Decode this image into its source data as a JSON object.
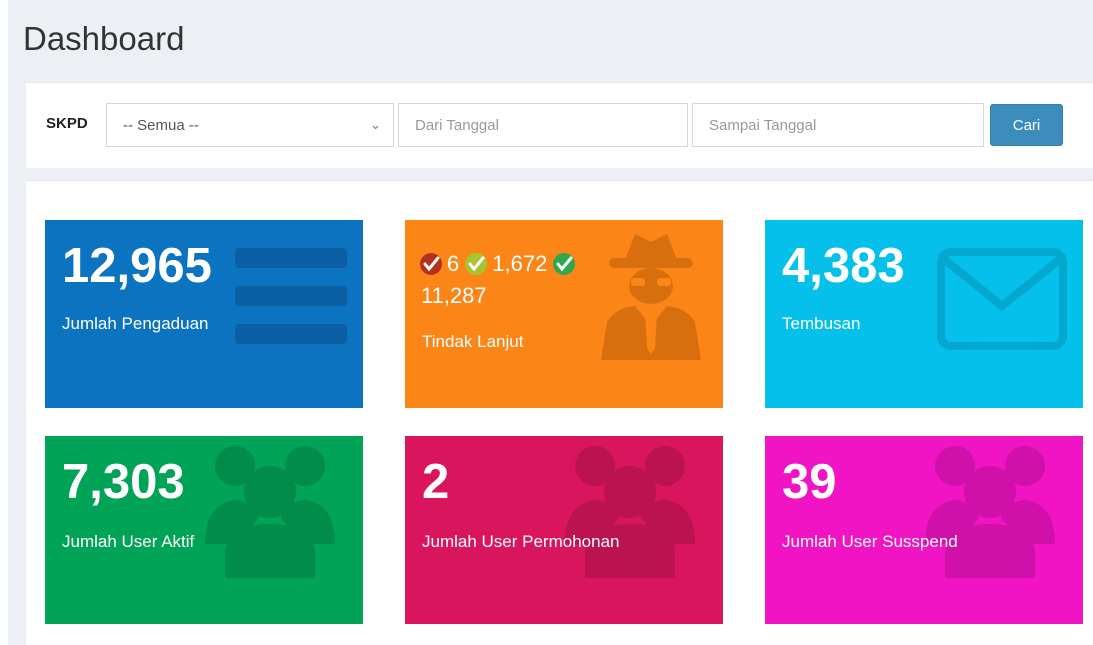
{
  "page": {
    "title": "Dashboard"
  },
  "filter": {
    "skpd_label": "SKPD",
    "skpd_selected": "-- Semua --",
    "from_placeholder": "Dari Tanggal",
    "to_placeholder": "Sampai Tanggal",
    "search_label": "Cari"
  },
  "cards": {
    "pengaduan": {
      "value": "12,965",
      "label": "Jumlah Pengaduan",
      "color": "#0c73c0",
      "icon": "list-icon"
    },
    "tindak_lanjut": {
      "rejected": "6",
      "processed": "1,672",
      "completed": "11,287",
      "label": "Tindak Lanjut",
      "color": "#fc8517",
      "icon": "user-secret-icon"
    },
    "tembusan": {
      "value": "4,383",
      "label": "Tembusan",
      "color": "#05c0ea",
      "icon": "envelope-icon"
    },
    "user_aktif": {
      "value": "7,303",
      "label": "Jumlah User Aktif",
      "color": "#01a357",
      "icon": "users-icon"
    },
    "user_permohonan": {
      "value": "2",
      "label": "Jumlah User Permohonan",
      "color": "#d9155d",
      "icon": "users-icon"
    },
    "user_suspend": {
      "value": "39",
      "label": "Jumlah User Susspend",
      "color": "#f014c5",
      "icon": "users-icon"
    }
  }
}
